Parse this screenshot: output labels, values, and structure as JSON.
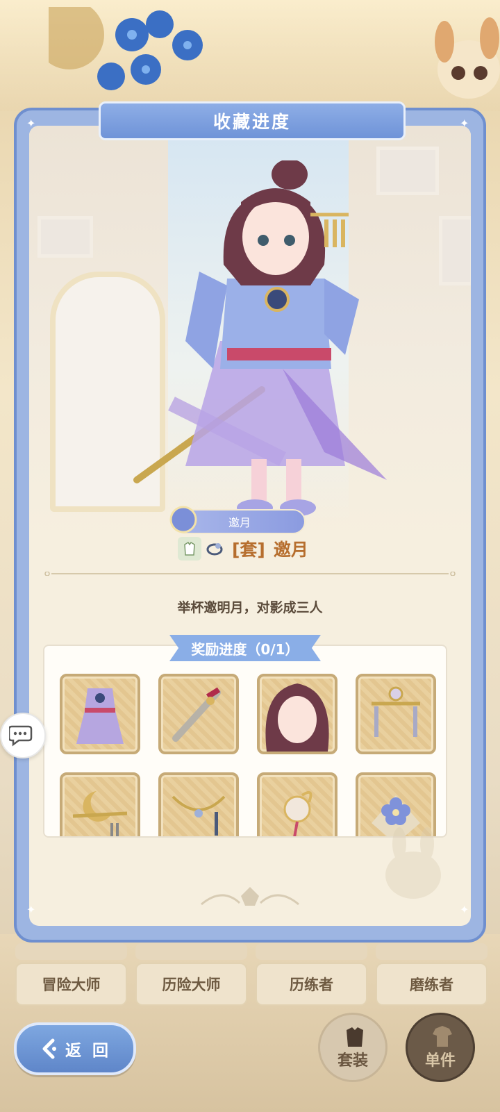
{
  "panel": {
    "title": "收藏进度"
  },
  "outfit": {
    "name": "邀月",
    "set_prefix": "[套]",
    "set_name": "邀月",
    "description": "举杯邀明月，对影成三人"
  },
  "reward": {
    "header": "奖励进度（0/1）",
    "items": [
      {
        "icon": "dress-icon"
      },
      {
        "icon": "sword-icon"
      },
      {
        "icon": "hairstyle-icon"
      },
      {
        "icon": "hair-ornament-icon"
      },
      {
        "icon": "moon-hairpin-icon"
      },
      {
        "icon": "necklace-icon"
      },
      {
        "icon": "flower-hairpin-icon"
      },
      {
        "icon": "blue-flower-icon"
      }
    ]
  },
  "tabs": [
    "冒险大师",
    "历险大师",
    "历练者",
    "磨练者"
  ],
  "buttons": {
    "back": "返 回",
    "set": "套装",
    "single": "单件"
  },
  "colors": {
    "panel_blue": "#6f8fcf",
    "title_blue": "#8eaee6",
    "set_text": "#b66e2e",
    "parchment": "#f6efdf"
  }
}
